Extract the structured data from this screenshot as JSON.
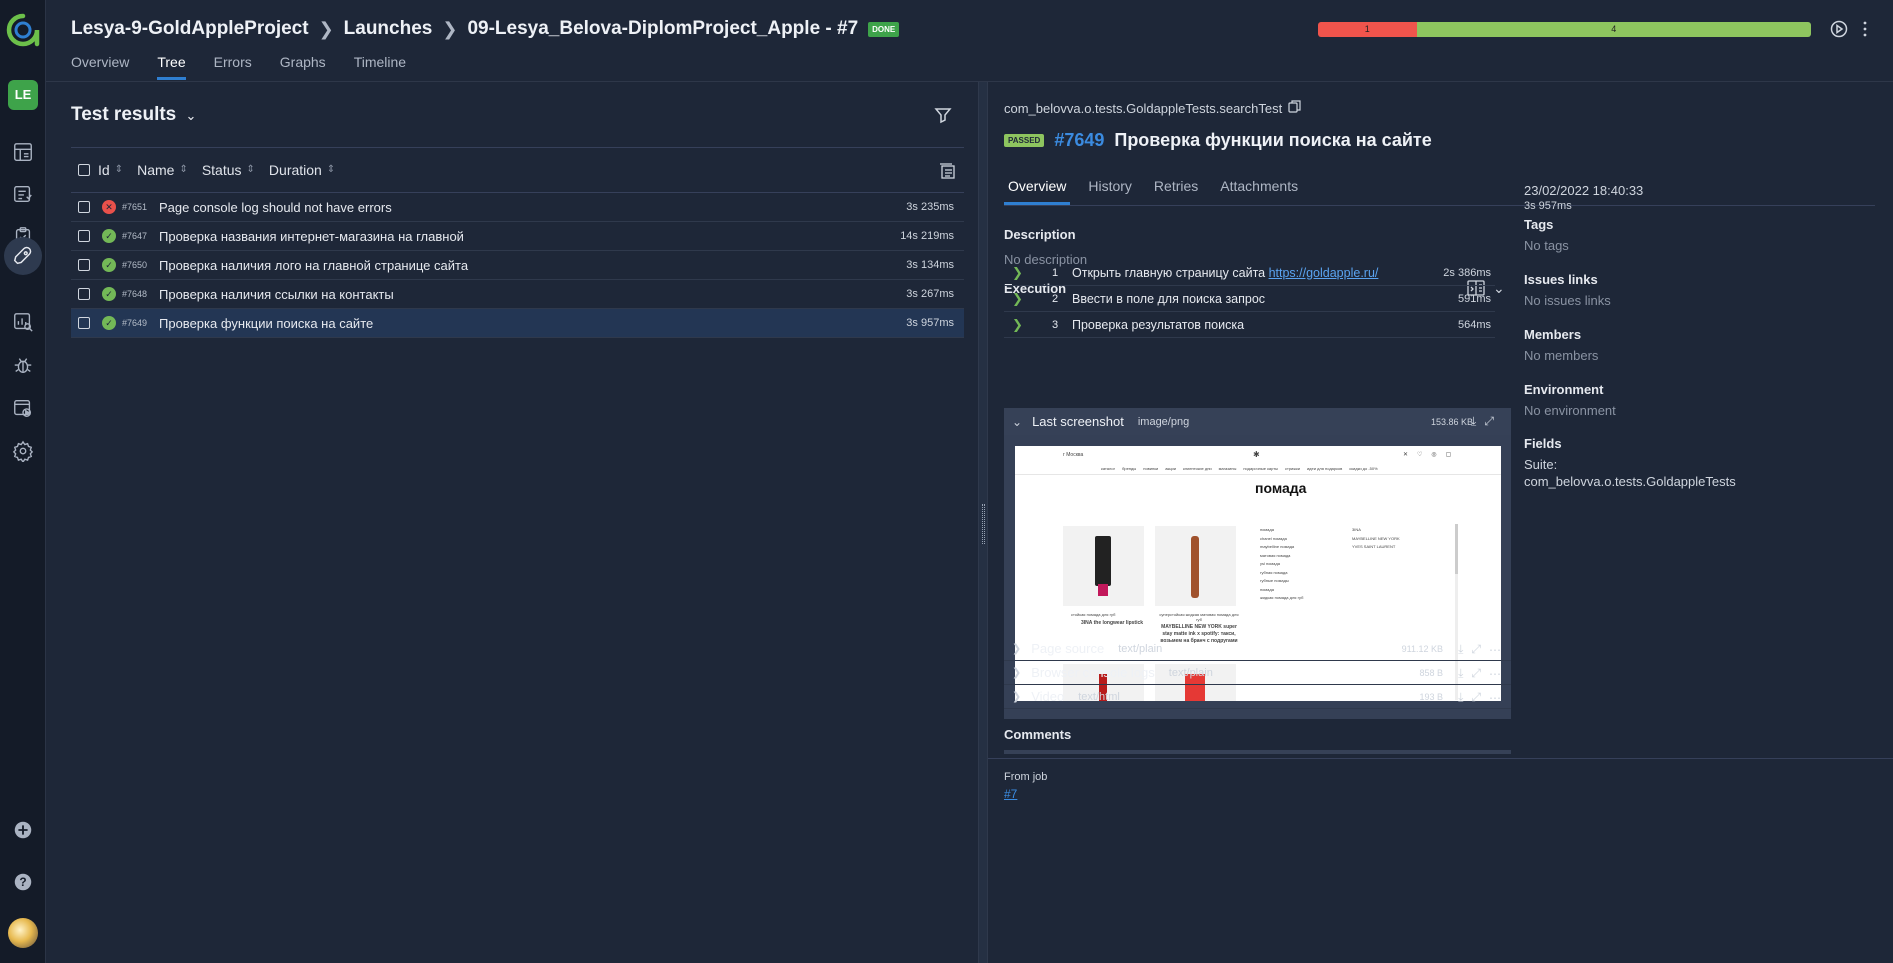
{
  "sidebar": {
    "user_initials": "LE"
  },
  "header": {
    "project": "Lesya-9-GoldAppleProject",
    "launches": "Launches",
    "launch": "09-Lesya_Belova-DiplomProject_Apple - #7",
    "status_badge": "DONE",
    "tabs": [
      "Overview",
      "Tree",
      "Errors",
      "Graphs",
      "Timeline"
    ],
    "active_tab": "Tree",
    "stats": {
      "failed": "1",
      "passed": "4"
    },
    "colors": {
      "failed": "#f0544c",
      "passed": "#8ec55f",
      "accent": "#2f7fd1"
    }
  },
  "tree": {
    "title": "Test results",
    "columns": {
      "id": "Id",
      "name": "Name",
      "status": "Status",
      "duration": "Duration"
    },
    "rows": [
      {
        "id": "#7651",
        "name": "Page console log should not have errors",
        "duration": "3s 235ms",
        "status": "failed"
      },
      {
        "id": "#7647",
        "name": "Проверка названия интернет-магазина на главной",
        "duration": "14s 219ms",
        "status": "passed"
      },
      {
        "id": "#7650",
        "name": "Проверка наличия лого на главной странице сайта",
        "duration": "3s 134ms",
        "status": "passed"
      },
      {
        "id": "#7648",
        "name": "Проверка наличия ссылки на контакты",
        "duration": "3s 267ms",
        "status": "passed"
      },
      {
        "id": "#7649",
        "name": "Проверка функции поиска на сайте",
        "duration": "3s 957ms",
        "status": "passed"
      }
    ]
  },
  "detail": {
    "full_name": "com_belovva.o.tests.GoldappleTests.searchTest",
    "status": "PASSED",
    "number": "#7649",
    "title": "Проверка функции поиска на сайте",
    "tabs": [
      "Overview",
      "History",
      "Retries",
      "Attachments"
    ],
    "description_label": "Description",
    "description": "No description",
    "execution_label": "Execution",
    "steps": [
      {
        "num": "1",
        "text": "Открыть главную страницу сайта ",
        "link": "https://goldapple.ru/",
        "duration": "2s 386ms"
      },
      {
        "num": "2",
        "text": "Ввести в поле для поиска запрос",
        "link": "",
        "duration": "591ms"
      },
      {
        "num": "3",
        "text": "Проверка результатов поиска",
        "link": "",
        "duration": "564ms"
      }
    ],
    "screenshot": {
      "name": "Last screenshot",
      "mime": "image/png",
      "size": "153.86 KB"
    },
    "attachments": [
      {
        "name": "Page source",
        "mime": "text/plain",
        "size": "911.12 KB"
      },
      {
        "name": "Browser console logs",
        "mime": "text/plain",
        "size": "858 B"
      },
      {
        "name": "Video",
        "mime": "text/html",
        "size": "193 B"
      }
    ],
    "comments_label": "Comments",
    "from_job_label": "From job",
    "from_job": "#7",
    "side": {
      "date": "23/02/2022 18:40:33",
      "duration": "3s 957ms",
      "tags_label": "Tags",
      "tags": "No tags",
      "issues_label": "Issues links",
      "issues": "No issues links",
      "members_label": "Members",
      "members": "No members",
      "env_label": "Environment",
      "env": "No environment",
      "fields_label": "Fields",
      "suite_label": "Suite:",
      "suite": "com_belovva.o.tests.GoldappleTests"
    }
  },
  "screenshot_content": {
    "city": "г Москва",
    "nav": [
      "каталог",
      "бренды",
      "новинки",
      "акции",
      "клиентские дни",
      "магазины",
      "подарочные карты",
      "стрижки",
      "идеи для подарков",
      "скидки до -50%"
    ],
    "heading": "помада",
    "suggestions": [
      "помада",
      "chanel помада",
      "maybelline помада",
      "матовая помада",
      "ysl помада",
      "губная помада",
      "губные помады",
      "помада",
      "жидкая помада для губ"
    ],
    "brands": [
      "3INA",
      "MAYBELLINE NEW YORK",
      "YVES SAINT LAURENT"
    ],
    "product1_sub": "стойкая помада для губ",
    "product1": "3INA the longwear lipstick",
    "product2_sub": "суперстойкая жидкая матовая помада для губ",
    "product2": "MAYBELLINE NEW YORK super stay matte ink x spotify: такси, возьмем на бранч с подругами"
  }
}
